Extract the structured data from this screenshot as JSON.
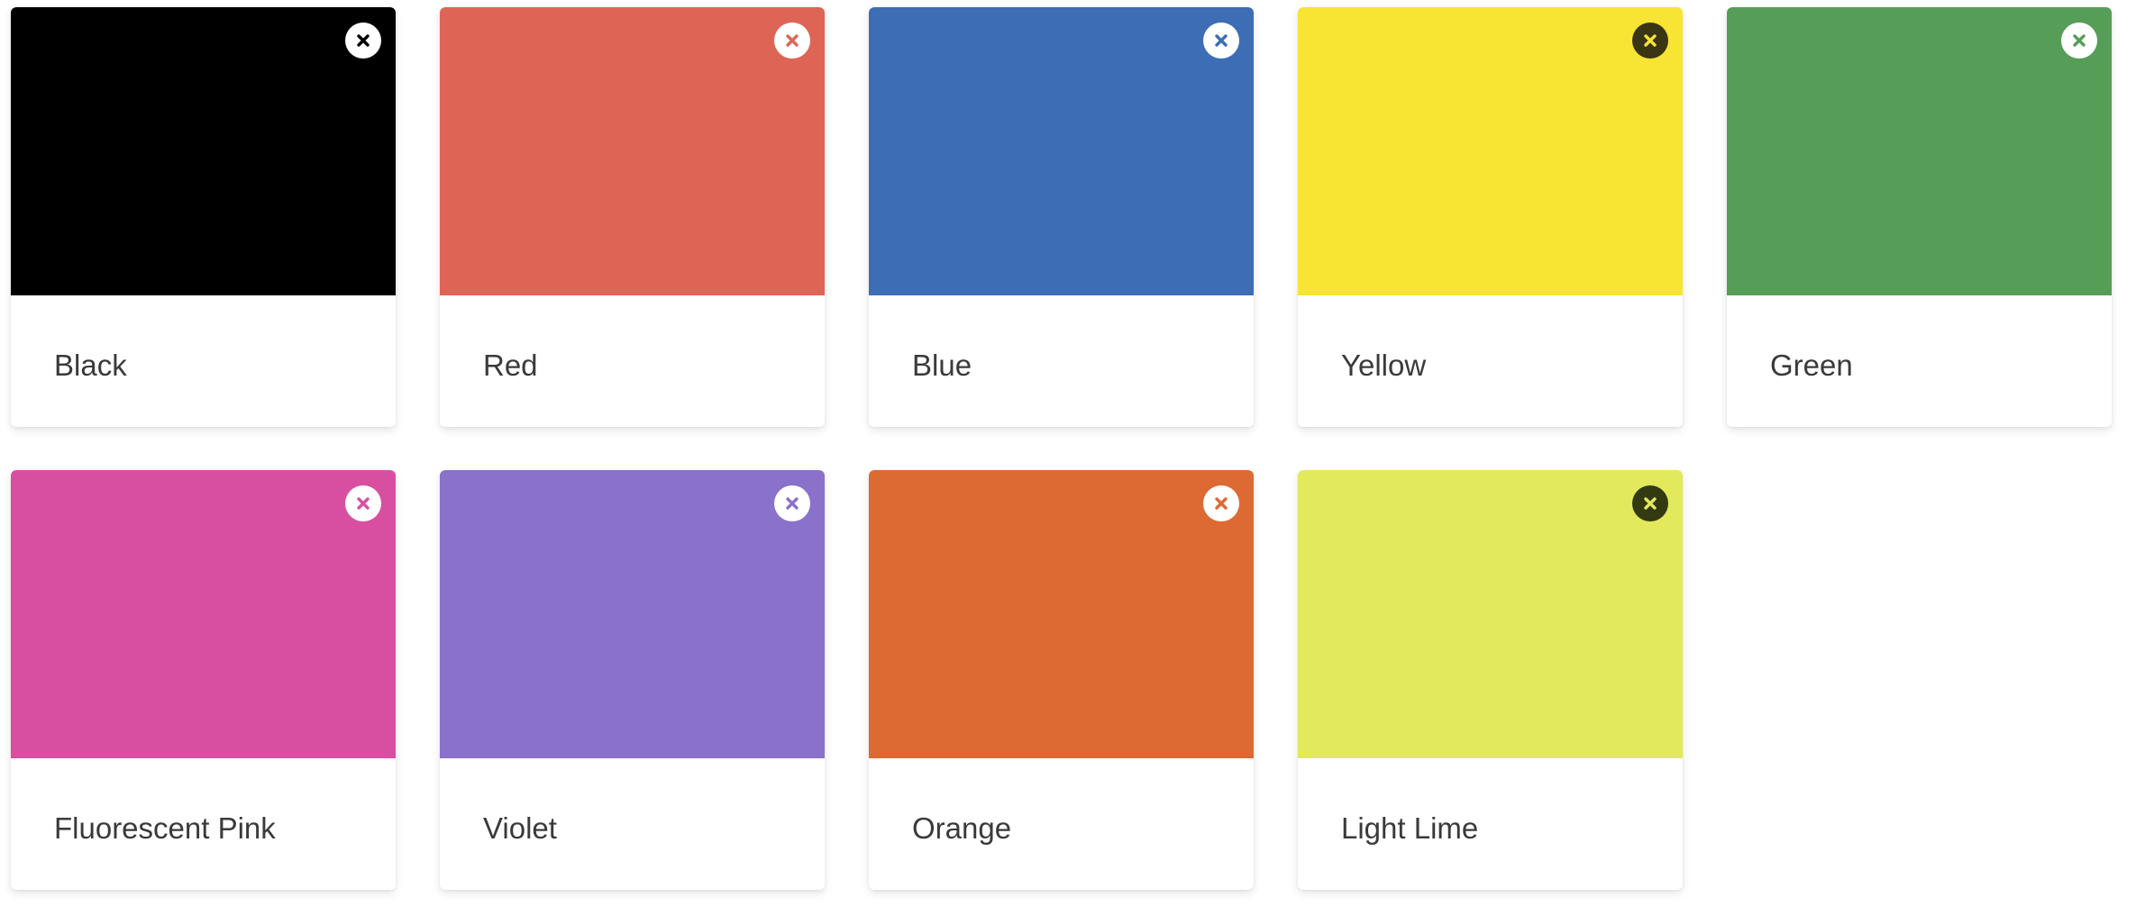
{
  "colors": [
    {
      "name": "Black",
      "hex": "#000000",
      "remove_bg": "#ffffff",
      "remove_fg": "#000000",
      "remove_icon": "close-icon"
    },
    {
      "name": "Red",
      "hex": "#de6556",
      "remove_bg": "#ffffff",
      "remove_fg": "#de6556",
      "remove_icon": "close-icon"
    },
    {
      "name": "Blue",
      "hex": "#3d6db5",
      "remove_bg": "#ffffff",
      "remove_fg": "#3d6db5",
      "remove_icon": "close-icon"
    },
    {
      "name": "Yellow",
      "hex": "#f7e433",
      "remove_bg": "#3a3512",
      "remove_fg": "#f7e433",
      "remove_icon": "close-icon"
    },
    {
      "name": "Green",
      "hex": "#569e58",
      "remove_bg": "#ffffff",
      "remove_fg": "#569e58",
      "remove_icon": "close-icon"
    },
    {
      "name": "Fluorescent Pink",
      "hex": "#d84fa2",
      "remove_bg": "#ffffff",
      "remove_fg": "#d84fa2",
      "remove_icon": "close-icon"
    },
    {
      "name": "Violet",
      "hex": "#8a71c9",
      "remove_bg": "#ffffff",
      "remove_fg": "#8a71c9",
      "remove_icon": "close-icon"
    },
    {
      "name": "Orange",
      "hex": "#dd6a33",
      "remove_bg": "#ffffff",
      "remove_fg": "#dd6a33",
      "remove_icon": "close-icon"
    },
    {
      "name": "Light Lime",
      "hex": "#e2e95d",
      "remove_bg": "#333a12",
      "remove_fg": "#e2e95d",
      "remove_icon": "close-icon"
    }
  ]
}
